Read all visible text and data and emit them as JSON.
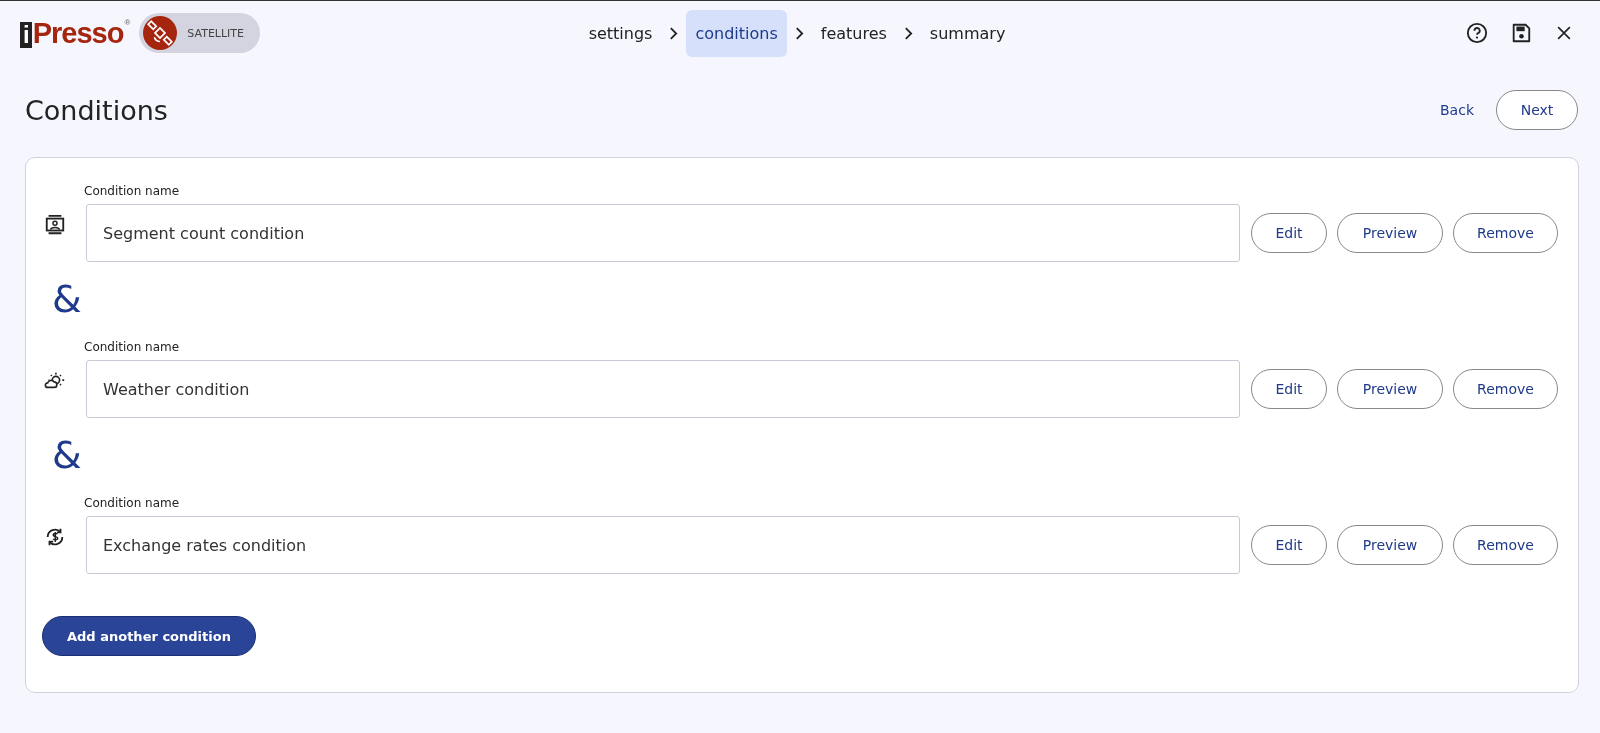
{
  "logo": {
    "prefix": "i",
    "name": "Presso",
    "mark": "®"
  },
  "mode_badge": {
    "label": "SATELLITE"
  },
  "steps": [
    {
      "label": "settings",
      "selected": false
    },
    {
      "label": "conditions",
      "selected": true
    },
    {
      "label": "features",
      "selected": false
    },
    {
      "label": "summary",
      "selected": false
    }
  ],
  "page_title": "Conditions",
  "nav": {
    "back": "Back",
    "next": "Next"
  },
  "conditions": [
    {
      "kind": "person",
      "label": "Condition name",
      "value": "Segment count condition",
      "buttons": [
        "Edit",
        "Preview",
        "Remove"
      ],
      "connector": "&"
    },
    {
      "kind": "weather",
      "label": "Condition name",
      "value": "Weather condition",
      "buttons": [
        "Edit",
        "Preview",
        "Remove"
      ],
      "connector": "&"
    },
    {
      "kind": "currency",
      "label": "Condition name",
      "value": "Exchange rates condition",
      "buttons": [
        "Edit",
        "Preview",
        "Remove"
      ]
    }
  ],
  "add_button": "Add another condition"
}
